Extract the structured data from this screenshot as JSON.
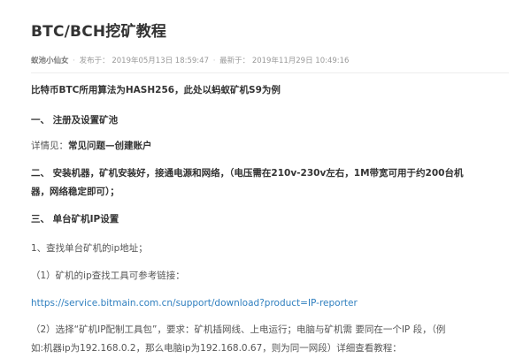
{
  "article": {
    "title": "BTC/BCH挖矿教程",
    "meta": {
      "author": "蚁池小仙女",
      "published_label": "发布于：",
      "published": "2019年05月13日 18:59:47",
      "updated_label": "最新于：",
      "updated": "2019年11月29日 10:49:16"
    },
    "paragraphs": {
      "intro": "比特币BTC所用算法为HASH256，此处以蚂蚁矿机S9为例",
      "step1_heading": "一、  注册及设置矿池",
      "details_prefix": "详情见：",
      "details_link": "常见问题—创建账户",
      "step2_line1": "二、  安装机器，矿机安装好，接通电源和网络，（电压需在210v-230v左右，1M带宽可用于约200台机",
      "step2_line2": "器，网络稳定即可）；",
      "step3_heading": "三、  单台矿机IP设置",
      "find_ip": "1、查找单台矿机的ip地址；",
      "tool_hint": "（1）矿机的ip查找工具可参考链接：",
      "tool_link": "https://service.bitmain.com.cn/support/download?product=IP-reporter",
      "select_line1": "（2）选择“矿机IP配制工具包”，要求：矿机插网线、上电运行；电脑与矿机需 要同在一个IP 段，（例",
      "select_line2": "如:机器ip为192.168.0.2，那么电脑ip为192.168.0.67，则为同一网段）详细查看教程："
    }
  }
}
